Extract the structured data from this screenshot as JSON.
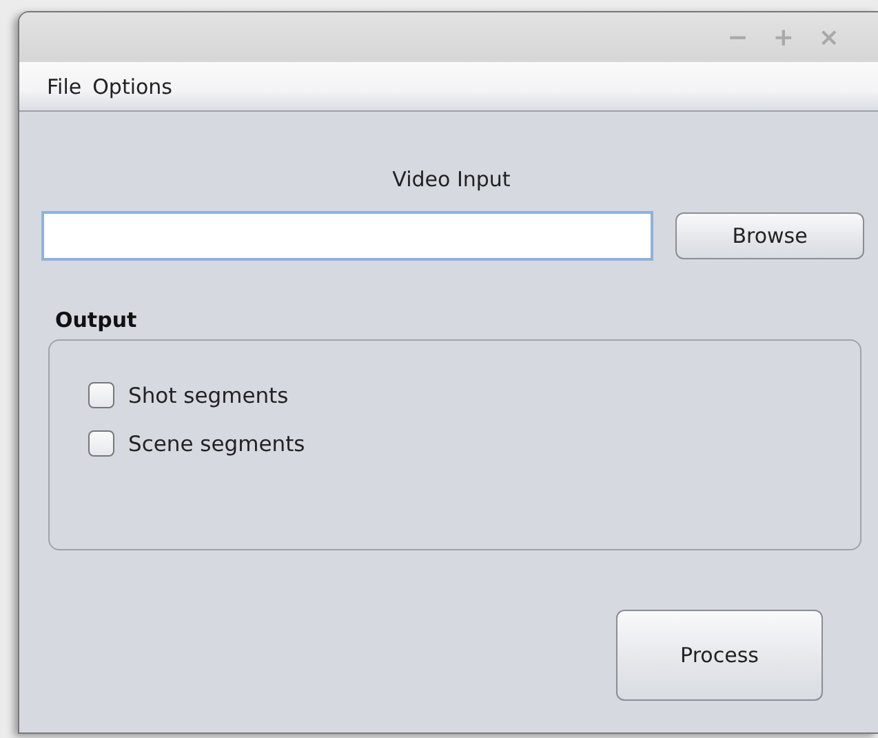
{
  "window": {
    "controls": [
      "−",
      "+",
      "×"
    ]
  },
  "menu": [
    "File",
    "Options"
  ],
  "video_input": {
    "label": "Video Input"
  },
  "browse_button": "Browse",
  "output": {
    "title": "Output",
    "options": [
      {
        "label": "Shot segments",
        "checked": false
      },
      {
        "label": "Scene segments",
        "checked": false
      }
    ]
  },
  "process_button": "Process"
}
